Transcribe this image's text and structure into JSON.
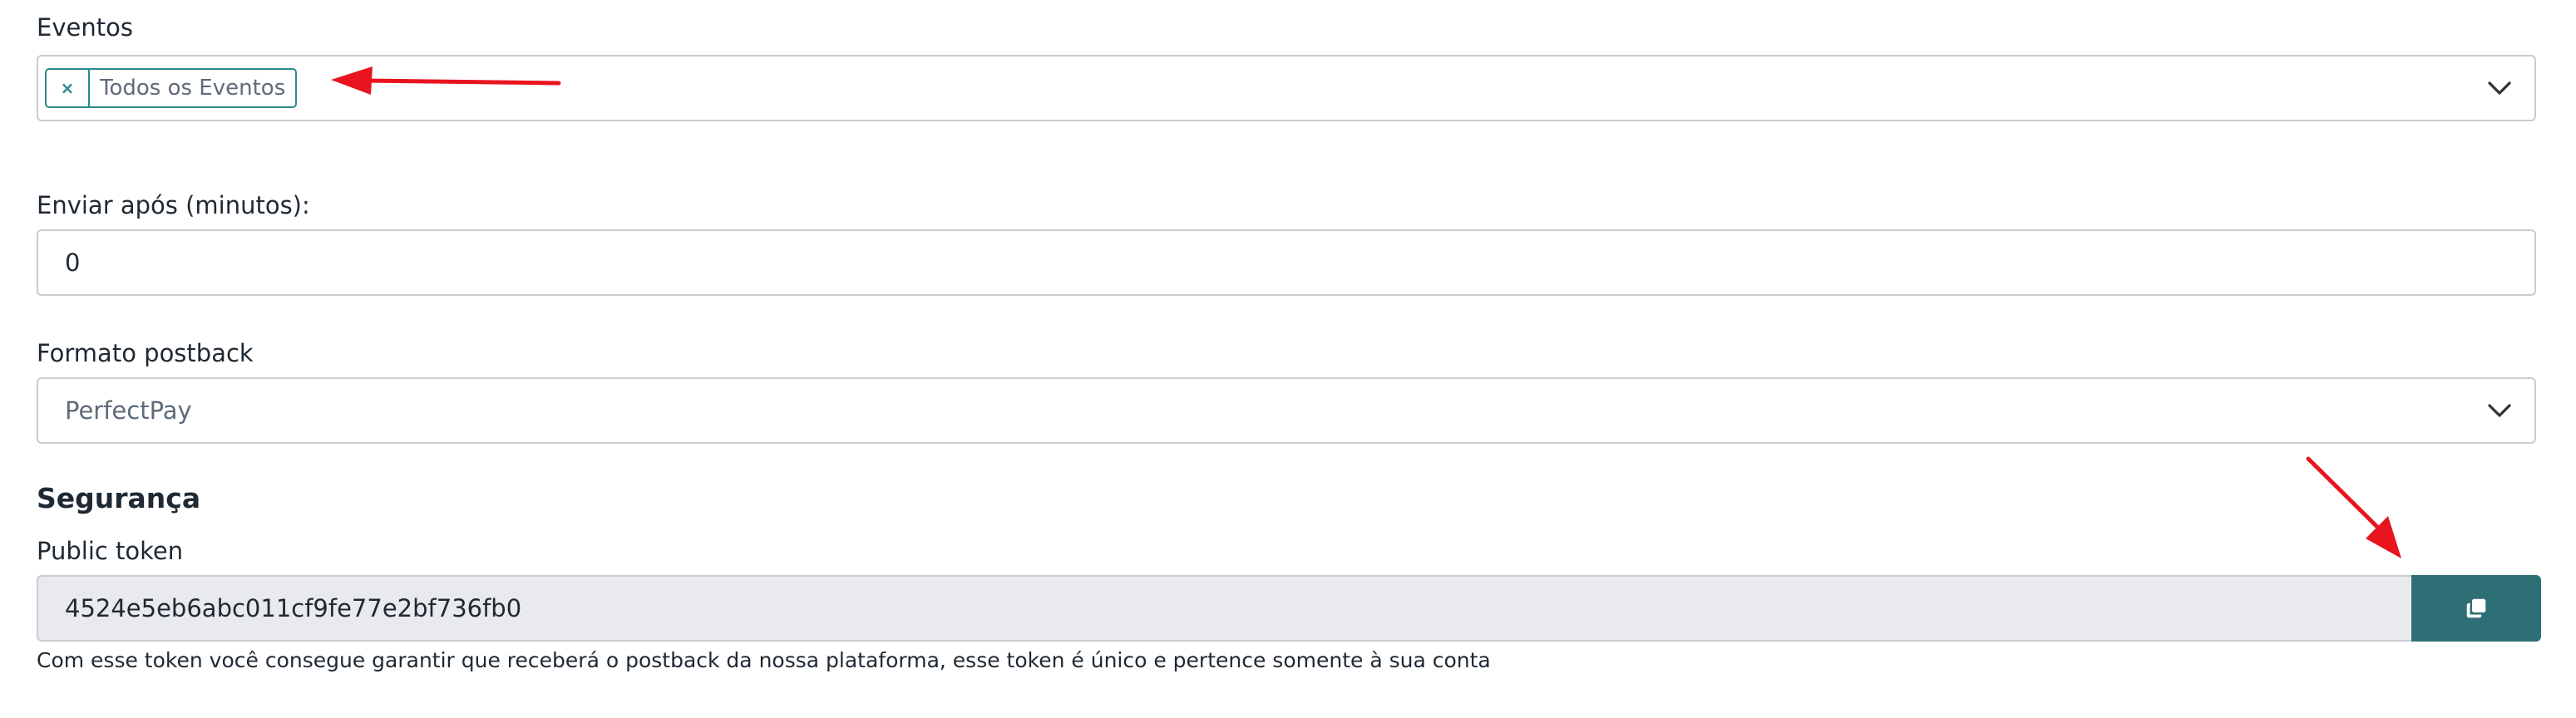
{
  "eventos": {
    "label": "Eventos",
    "tag_remove": "×",
    "tag_text": "Todos os Eventos"
  },
  "enviar_apos": {
    "label": "Enviar após (minutos):",
    "value": "0"
  },
  "formato": {
    "label": "Formato postback",
    "selected": "PerfectPay"
  },
  "seguranca": {
    "heading": "Segurança",
    "token_label": "Public token",
    "token_value": "4524e5eb6abc011cf9fe77e2bf736fb0",
    "help_text": "Com esse token você consegue garantir que receberá o postback da nossa plataforma, esse token é único e pertence somente à sua conta"
  },
  "icons": {
    "dropdown": "chevron-down-icon",
    "copy": "copy-icon",
    "annotation_arrow_color": "#e8141e",
    "accent": "#2e6f76"
  }
}
